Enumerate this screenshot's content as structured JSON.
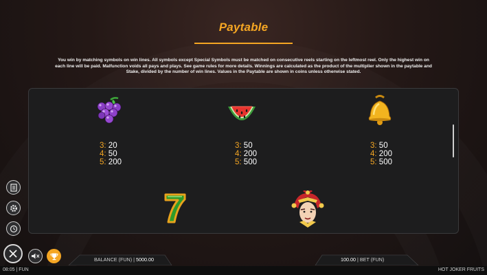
{
  "header": {
    "title": "Paytable"
  },
  "intro_text": "You win by matching symbols on win lines. All symbols except Special Symbols must be matched on consecutive reels starting on the leftmost reel. Only the highest win on each line will be paid. Malfunction voids all pays and plays. See game rules for more details. Winnings are calculated as the product of the multiplier shown in the paytable and Stake, divided by the number of win lines. Values in the Paytable are shown in coins unless otherwise stated.",
  "symbols": [
    {
      "icon": "grapes-icon",
      "pays": [
        {
          "count": "3:",
          "value": "20"
        },
        {
          "count": "4:",
          "value": "50"
        },
        {
          "count": "5:",
          "value": "200"
        }
      ]
    },
    {
      "icon": "watermelon-icon",
      "pays": [
        {
          "count": "3:",
          "value": "50"
        },
        {
          "count": "4:",
          "value": "200"
        },
        {
          "count": "5:",
          "value": "500"
        }
      ]
    },
    {
      "icon": "bell-icon",
      "pays": [
        {
          "count": "3:",
          "value": "50"
        },
        {
          "count": "4:",
          "value": "200"
        },
        {
          "count": "5:",
          "value": "500"
        }
      ]
    },
    {
      "icon": "seven-icon"
    },
    {
      "icon": "joker-icon"
    }
  ],
  "controls": {
    "side_buttons": [
      "paytable-icon",
      "settings-icon",
      "history-icon"
    ],
    "close": "close-icon",
    "sound": "sound-muted-icon",
    "trophy": "trophy-icon"
  },
  "footer": {
    "balance_label": "BALANCE (FUN)",
    "balance_sep": "|",
    "balance_value": "5000.00",
    "bet_value": "100.00",
    "bet_sep": "|",
    "bet_label": "BET (FUN)"
  },
  "status": {
    "time": "08:05",
    "sep": "|",
    "mode": "FUN",
    "game_name": "HOT JOKER FRUITS"
  },
  "colors": {
    "accent": "#f5a623",
    "panel": "#1d1d1e",
    "background": "#241816"
  }
}
